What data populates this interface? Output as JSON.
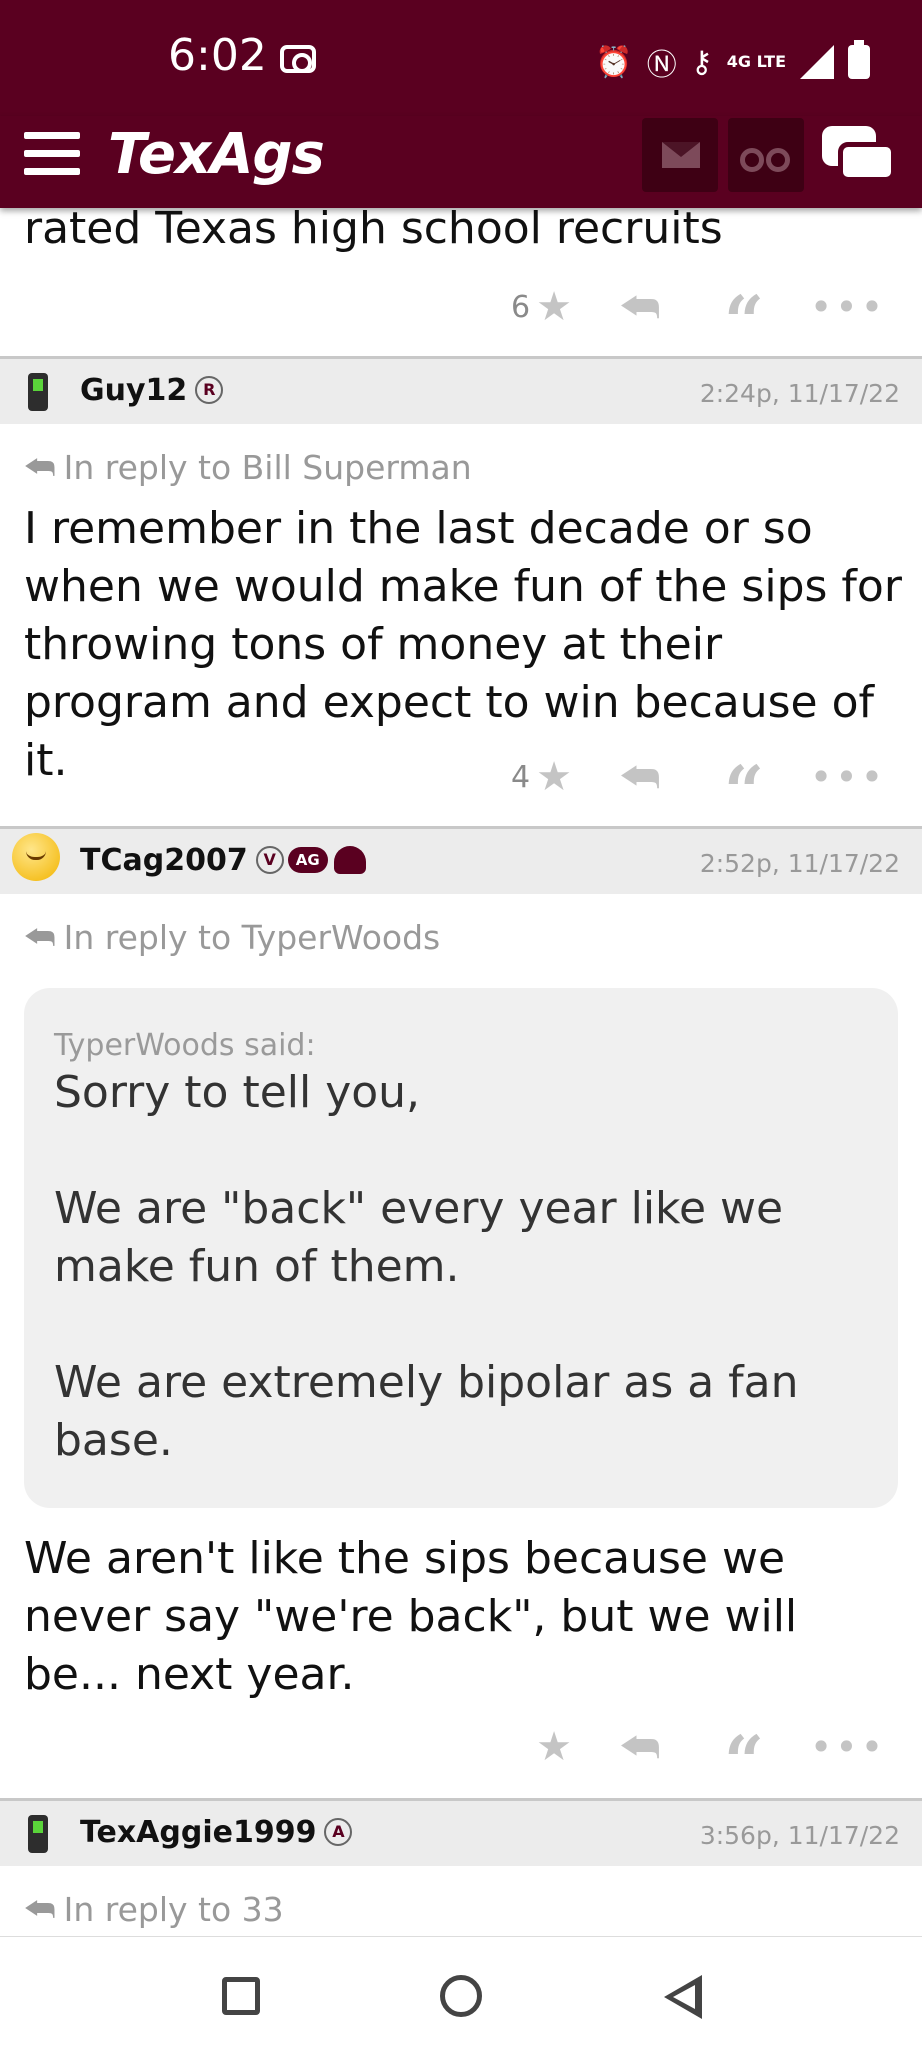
{
  "status_bar": {
    "time": "6:02",
    "network": "4G LTE"
  },
  "header": {
    "app_name": "TexAgs"
  },
  "posts": [
    {
      "text": "rated Texas high school recruits",
      "star_count": "6"
    },
    {
      "username": "Guy12",
      "badge": "R",
      "timestamp": "2:24p, 11/17/22",
      "reply_to": "In reply to Bill Superman",
      "text": "I remember in the last decade or so when we would make fun of the sips for throwing tons of money at their program and expect to win because of it.",
      "star_count": "4"
    },
    {
      "username": "TCag2007",
      "badge": "V",
      "badge2": "AG",
      "timestamp": "2:52p, 11/17/22",
      "reply_to": "In reply to TyperWoods",
      "quote_author": "TyperWoods said:",
      "quote_text": "Sorry to tell you,\n\nWe are \"back\" every year like we make fun of them.\n\nWe are extremely bipolar as a fan base.",
      "text": "We aren't like the sips because we never say \"we're back\", but we will be... next year.",
      "star_count": ""
    },
    {
      "username": "TexAggie1999",
      "badge": "A",
      "timestamp": "3:56p, 11/17/22",
      "reply_to": "In reply to 33"
    }
  ],
  "icons": {
    "menu": "hamburger-icon",
    "mail": "mail-icon",
    "watch": "binoculars-icon",
    "chat": "chat-icon",
    "star": "star-icon",
    "reply": "reply-icon",
    "quote": "quote-icon",
    "more": "more-icon"
  },
  "colors": {
    "brand": "#5a0020",
    "header_bg": "#ececec"
  }
}
